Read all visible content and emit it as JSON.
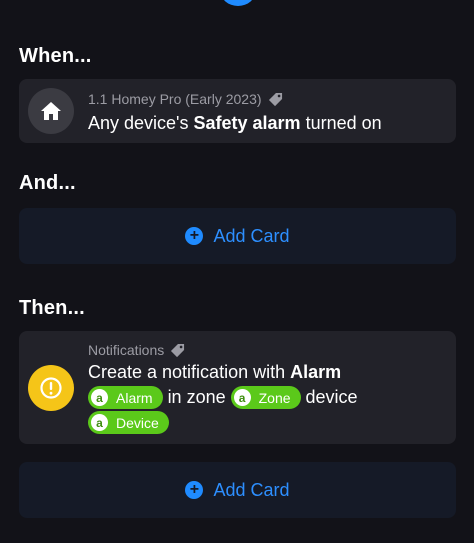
{
  "sections": {
    "when": "When...",
    "and": "And...",
    "then": "Then..."
  },
  "when_card": {
    "device": "1.1 Homey Pro (Early 2023)",
    "text_prefix": "Any device's ",
    "text_bold": "Safety alarm",
    "text_suffix": " turned on",
    "icon": "home-icon"
  },
  "and_add": {
    "label": "Add Card"
  },
  "then_card": {
    "category": "Notifications",
    "line1_prefix": "Create a notification with ",
    "line1_bold": "Alarm",
    "token_letter": "a",
    "token_alarm": "Alarm",
    "in_zone": "in zone",
    "token_zone": "Zone",
    "device_word": "device",
    "token_device": "Device",
    "icon": "exclamation-icon"
  },
  "then_add": {
    "label": "Add Card"
  },
  "colors": {
    "accent": "#1f8bff",
    "token_green": "#5bc91a",
    "notification_yellow": "#f5c518",
    "card_bg": "#222229"
  }
}
